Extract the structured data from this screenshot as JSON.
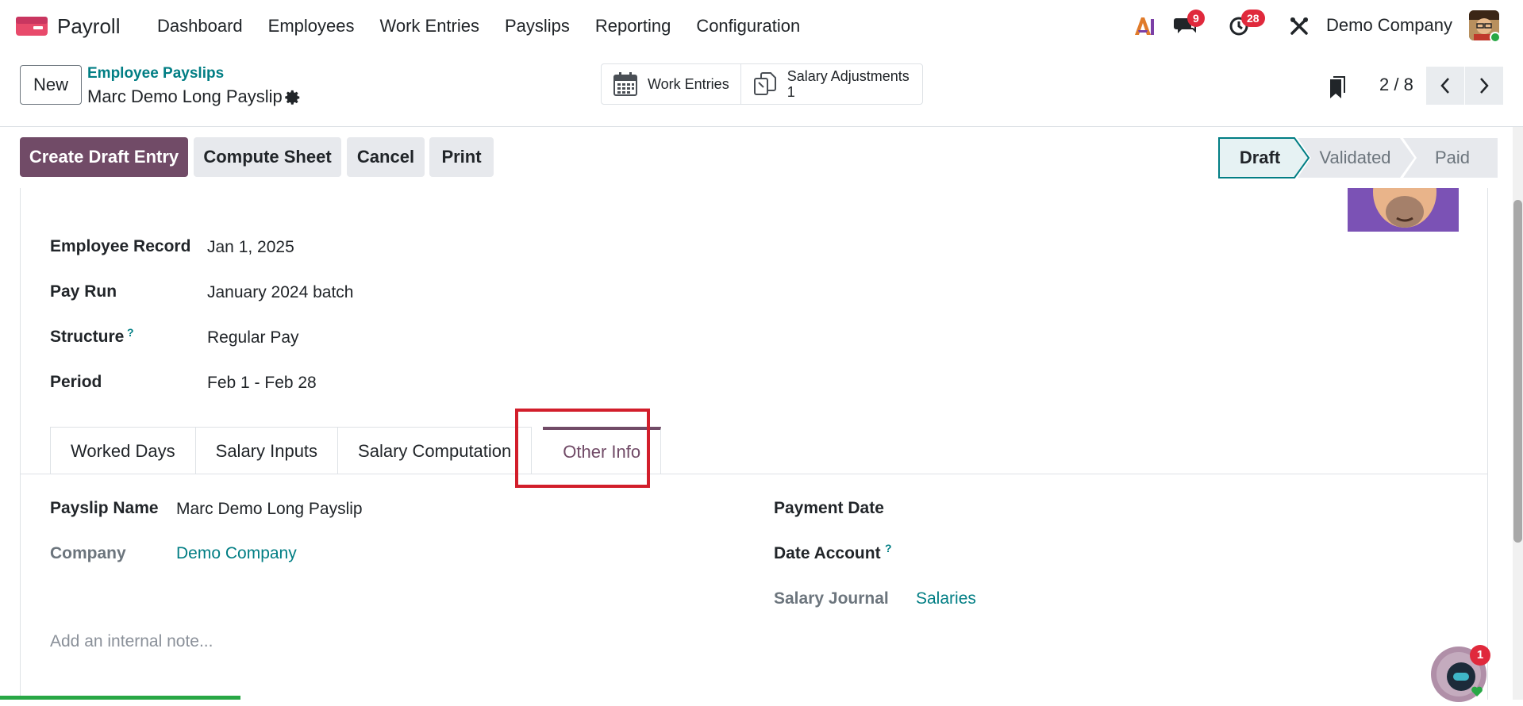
{
  "app": {
    "name": "Payroll",
    "menu": [
      "Dashboard",
      "Employees",
      "Work Entries",
      "Payslips",
      "Reporting",
      "Configuration"
    ]
  },
  "systray": {
    "messages_count": "9",
    "activities_count": "28",
    "company": "Demo Company"
  },
  "control_panel": {
    "new_label": "New",
    "breadcrumb": "Employee Payslips",
    "record_title": "Marc Demo Long Payslip",
    "smart_buttons": {
      "work_entries": "Work Entries",
      "salary_adjustments": "Salary Adjustments",
      "salary_adjustments_count": "1"
    },
    "pager": "2 / 8"
  },
  "actions": {
    "create_draft_entry": "Create Draft Entry",
    "compute_sheet": "Compute Sheet",
    "cancel": "Cancel",
    "print": "Print"
  },
  "stages": {
    "draft": "Draft",
    "validated": "Validated",
    "paid": "Paid",
    "current": "Draft"
  },
  "form": {
    "employee_record_label": "Employee Record",
    "employee_record_value": "Jan 1, 2025",
    "pay_run_label": "Pay Run",
    "pay_run_value": "January 2024 batch",
    "structure_label": "Structure",
    "structure_help": "?",
    "structure_value": "Regular Pay",
    "period_label": "Period",
    "period_value": "Feb 1 - Feb 28"
  },
  "tabs": {
    "worked_days": "Worked Days",
    "salary_inputs": "Salary Inputs",
    "salary_computation": "Salary Computation",
    "other_info": "Other Info",
    "active": "Other Info"
  },
  "other_info": {
    "payslip_name_label": "Payslip Name",
    "payslip_name_value": "Marc Demo Long Payslip",
    "company_label": "Company",
    "company_value": "Demo Company",
    "payment_date_label": "Payment Date",
    "date_account_label": "Date Account",
    "date_account_help": "?",
    "salary_journal_label": "Salary Journal",
    "salary_journal_value": "Salaries",
    "note_placeholder": "Add an internal note..."
  },
  "chat": {
    "unread": "1"
  },
  "colors": {
    "brand": "#714b67",
    "link": "#017e84",
    "badge": "#e0293c",
    "highlight": "#d21e2b"
  }
}
